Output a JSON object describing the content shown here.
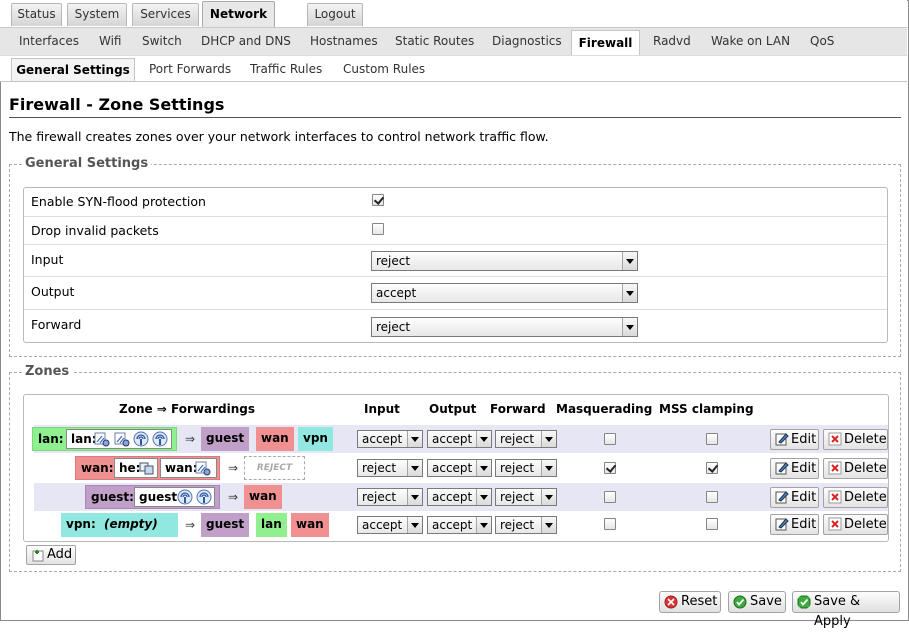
{
  "nav_main": [
    {
      "label": "Status",
      "active": false
    },
    {
      "label": "System",
      "active": false
    },
    {
      "label": "Services",
      "active": false
    },
    {
      "label": "Network",
      "active": true
    },
    {
      "label": "Logout",
      "active": false
    }
  ],
  "nav_network": [
    {
      "label": "Interfaces",
      "active": false
    },
    {
      "label": "Wifi",
      "active": false
    },
    {
      "label": "Switch",
      "active": false
    },
    {
      "label": "DHCP and DNS",
      "active": false
    },
    {
      "label": "Hostnames",
      "active": false
    },
    {
      "label": "Static Routes",
      "active": false
    },
    {
      "label": "Diagnostics",
      "active": false
    },
    {
      "label": "Firewall",
      "active": true
    },
    {
      "label": "Radvd",
      "active": false
    },
    {
      "label": "Wake on LAN",
      "active": false
    },
    {
      "label": "QoS",
      "active": false
    }
  ],
  "nav_firewall": [
    {
      "label": "General Settings",
      "active": true
    },
    {
      "label": "Port Forwards",
      "active": false
    },
    {
      "label": "Traffic Rules",
      "active": false
    },
    {
      "label": "Custom Rules",
      "active": false
    }
  ],
  "page": {
    "title": "Firewall - Zone Settings",
    "description": "The firewall creates zones over your network interfaces to control network traffic flow."
  },
  "general": {
    "legend": "General Settings",
    "syn_label": "Enable SYN-flood protection",
    "syn_checked": true,
    "drop_label": "Drop invalid packets",
    "drop_checked": false,
    "input_label": "Input",
    "input_value": "reject",
    "output_label": "Output",
    "output_value": "accept",
    "forward_label": "Forward",
    "forward_value": "reject"
  },
  "zones": {
    "legend": "Zones",
    "headers": {
      "zone": "Zone ⇒ Forwardings",
      "input": "Input",
      "output": "Output",
      "forward": "Forward",
      "masq": "Masquerading",
      "mss": "MSS clamping"
    },
    "arrow": "⇒",
    "edit_label": "Edit",
    "delete_label": "Delete",
    "add_label": "Add",
    "reject_tag": "REJECT",
    "colors": {
      "lan": "#90f090",
      "wan": "#f09090",
      "guest": "#c0a0c8",
      "vpn": "#90e8e0"
    },
    "rows": [
      {
        "name": "lan:",
        "ifaces": [
          "lan:"
        ],
        "forwards": [
          "guest",
          "wan",
          "vpn"
        ],
        "input": "accept",
        "output": "accept",
        "forward": "reject",
        "masq": false,
        "mss": false
      },
      {
        "name": "wan:",
        "ifaces": [
          "he:",
          "wan:"
        ],
        "forwards": [],
        "input": "reject",
        "output": "accept",
        "forward": "reject",
        "masq": true,
        "mss": true
      },
      {
        "name": "guest:",
        "ifaces": [
          "guest:"
        ],
        "forwards": [
          "wan"
        ],
        "input": "reject",
        "output": "accept",
        "forward": "reject",
        "masq": false,
        "mss": false
      },
      {
        "name": "vpn:",
        "ifaces": [
          "(empty)"
        ],
        "forwards": [
          "guest",
          "lan",
          "wan"
        ],
        "input": "accept",
        "output": "accept",
        "forward": "reject",
        "masq": false,
        "mss": false
      }
    ]
  },
  "footer": {
    "reset": "Reset",
    "save": "Save",
    "save_apply": "Save & Apply"
  },
  "icons": [
    "ethernet-icon",
    "wifi-icon",
    "tunnel-icon",
    "edit-icon",
    "delete-icon",
    "add-icon",
    "reset-icon",
    "save-icon",
    "save-apply-icon"
  ]
}
